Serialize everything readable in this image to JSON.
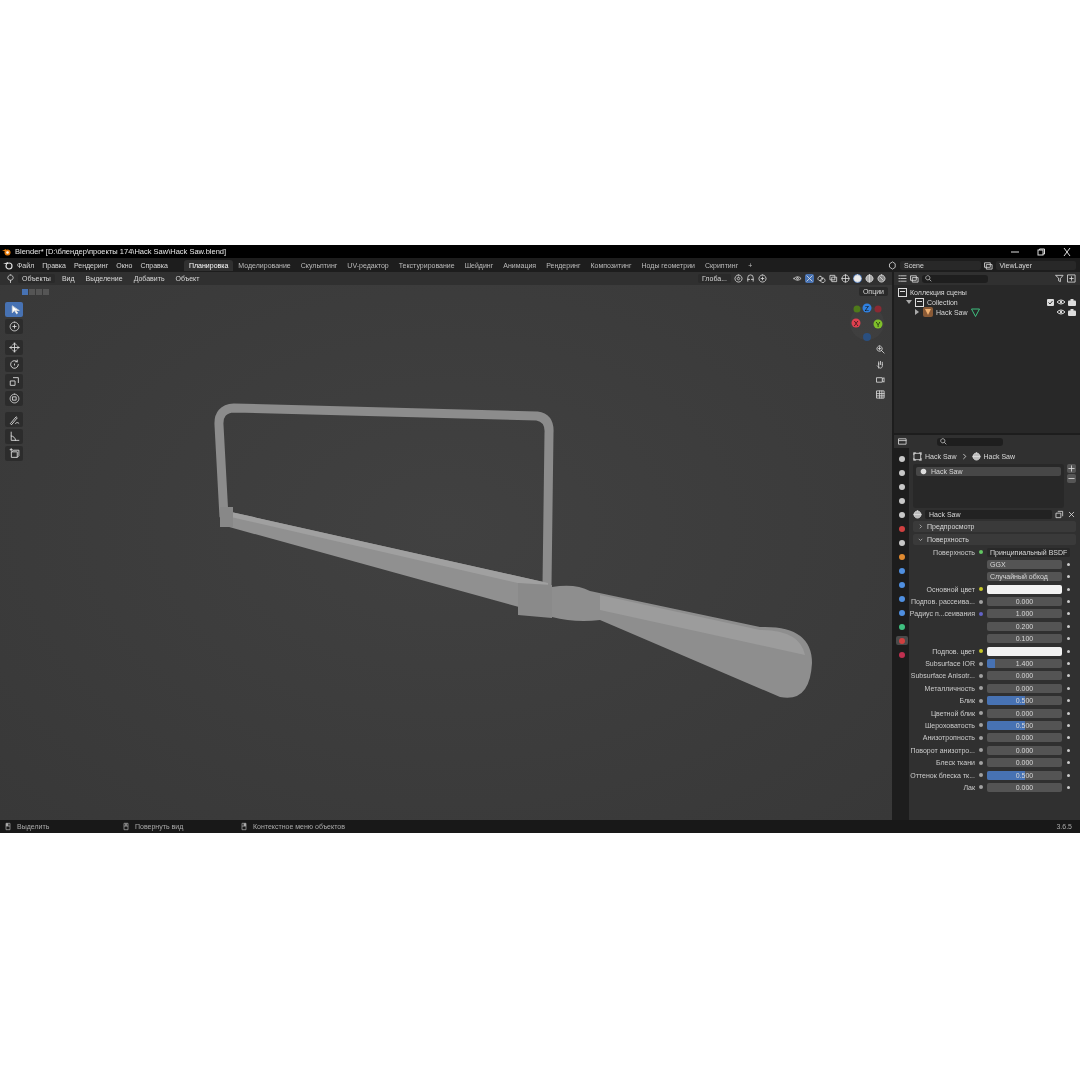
{
  "window": {
    "title": "Blender* [D:\\блендер\\проекты 174\\Hack Saw\\Hack Saw.blend]"
  },
  "menu": [
    "Файл",
    "Правка",
    "Рендеринг",
    "Окно",
    "Справка"
  ],
  "workspaces": [
    {
      "label": "Планировка",
      "selected": true
    },
    {
      "label": "Моделирование",
      "selected": false
    },
    {
      "label": "Скульптинг",
      "selected": false
    },
    {
      "label": "UV-редактор",
      "selected": false
    },
    {
      "label": "Текстурирование",
      "selected": false
    },
    {
      "label": "Шейдинг",
      "selected": false
    },
    {
      "label": "Анимация",
      "selected": false
    },
    {
      "label": "Рендеринг",
      "selected": false
    },
    {
      "label": "Композитинг",
      "selected": false
    },
    {
      "label": "Ноды геометрии",
      "selected": false
    },
    {
      "label": "Скриптинг",
      "selected": false
    }
  ],
  "add_workspace": "+",
  "scene": "Scene",
  "view_layer": "ViewLayer",
  "viewport": {
    "mode": "Объекты",
    "menus": [
      "Вид",
      "Выделение",
      "Добавить",
      "Объект"
    ],
    "orientation": "Глоба...",
    "options": "Опции",
    "tools": [
      {
        "kind": "select",
        "selected": true
      },
      {
        "kind": "cursor",
        "selected": false
      },
      {
        "kind": "move",
        "selected": false
      },
      {
        "kind": "rotate",
        "selected": false
      },
      {
        "kind": "scale",
        "selected": false
      },
      {
        "kind": "transform",
        "selected": false
      },
      {
        "kind": "annotate",
        "selected": false
      },
      {
        "kind": "measure",
        "selected": false
      },
      {
        "kind": "add-cube",
        "selected": false
      }
    ],
    "gizmo": [
      {
        "label": "Z",
        "color": "#2f80e0"
      },
      {
        "label": "X",
        "color": "#e0404f"
      },
      {
        "label": "Y",
        "color": "#7fbf2a"
      }
    ]
  },
  "outliner": {
    "tree": [
      {
        "label": "Коллекция сцены",
        "kind": "scene",
        "children": [
          {
            "label": "Collection",
            "kind": "collection",
            "expanded": true,
            "children": [
              {
                "label": "Hack Saw",
                "kind": "object",
                "expanded": false
              }
            ]
          }
        ]
      }
    ]
  },
  "properties": {
    "tabs": [
      {
        "kind": "tool",
        "selected": false
      },
      {
        "kind": "render",
        "selected": false
      },
      {
        "kind": "output",
        "selected": false
      },
      {
        "kind": "view-layer",
        "selected": false
      },
      {
        "kind": "scene",
        "selected": false
      },
      {
        "kind": "world",
        "selected": false
      },
      {
        "kind": "collection",
        "selected": false
      },
      {
        "kind": "object",
        "selected": false
      },
      {
        "kind": "modifier",
        "selected": false
      },
      {
        "kind": "particles",
        "selected": false
      },
      {
        "kind": "physics",
        "selected": false
      },
      {
        "kind": "constraints",
        "selected": false
      },
      {
        "kind": "data",
        "selected": false
      },
      {
        "kind": "material",
        "selected": true
      },
      {
        "kind": "texture",
        "selected": false
      }
    ],
    "breadcrumb": [
      "Hack Saw",
      "Hack Saw"
    ],
    "slots": [
      {
        "label": "Hack Saw",
        "selected": true
      }
    ],
    "material": "Hack Saw",
    "panels": [
      {
        "title": "Предпросмотр",
        "expanded": false
      },
      {
        "title": "Поверхность",
        "expanded": true
      }
    ],
    "rows": [
      {
        "kind": "node",
        "label": "Поверхность",
        "value": "Принципиальный BSDF"
      },
      {
        "kind": "dropdown",
        "value": "GGX"
      },
      {
        "kind": "dropdown",
        "value": "Случайный обход"
      },
      {
        "kind": "color",
        "label": "Основной цвет",
        "color": "#f2f2f2"
      },
      {
        "kind": "number",
        "label": "Подпов. рассеива...",
        "value": "0.000"
      },
      {
        "kind": "vector",
        "label": "Радиус п...сеивания",
        "values": [
          "1.000",
          "0.200",
          "0.100"
        ]
      },
      {
        "kind": "color",
        "label": "Подпов. цвет",
        "color": "#f2f2f2"
      },
      {
        "kind": "number",
        "label": "Subsurface IOR",
        "value": "1.400",
        "level": 0.1
      },
      {
        "kind": "number",
        "label": "Subsurface Anisotr...",
        "value": "0.000"
      },
      {
        "kind": "number",
        "label": "Металличность",
        "value": "0.000"
      },
      {
        "kind": "number",
        "label": "Блик",
        "value": "0.500",
        "level": 0.5
      },
      {
        "kind": "number",
        "label": "Цветной блик",
        "value": "0.000"
      },
      {
        "kind": "number",
        "label": "Шероховатость",
        "value": "0.500",
        "level": 0.5
      },
      {
        "kind": "number",
        "label": "Анизотропность",
        "value": "0.000"
      },
      {
        "kind": "number",
        "label": "Поворот анизотро...",
        "value": "0.000"
      },
      {
        "kind": "number",
        "label": "Блеск ткани",
        "value": "0.000"
      },
      {
        "kind": "number",
        "label": "Оттенок блеска тк...",
        "value": "0.500",
        "level": 0.5
      },
      {
        "kind": "number",
        "label": "Лак",
        "value": "0.000"
      }
    ]
  },
  "status": [
    {
      "kind": "left-click",
      "label": "Выделить"
    },
    {
      "kind": "middle-click",
      "label": "Повернуть вид"
    },
    {
      "kind": "right-click",
      "label": "Контекстное меню объектов"
    }
  ],
  "version": "3.6.5"
}
